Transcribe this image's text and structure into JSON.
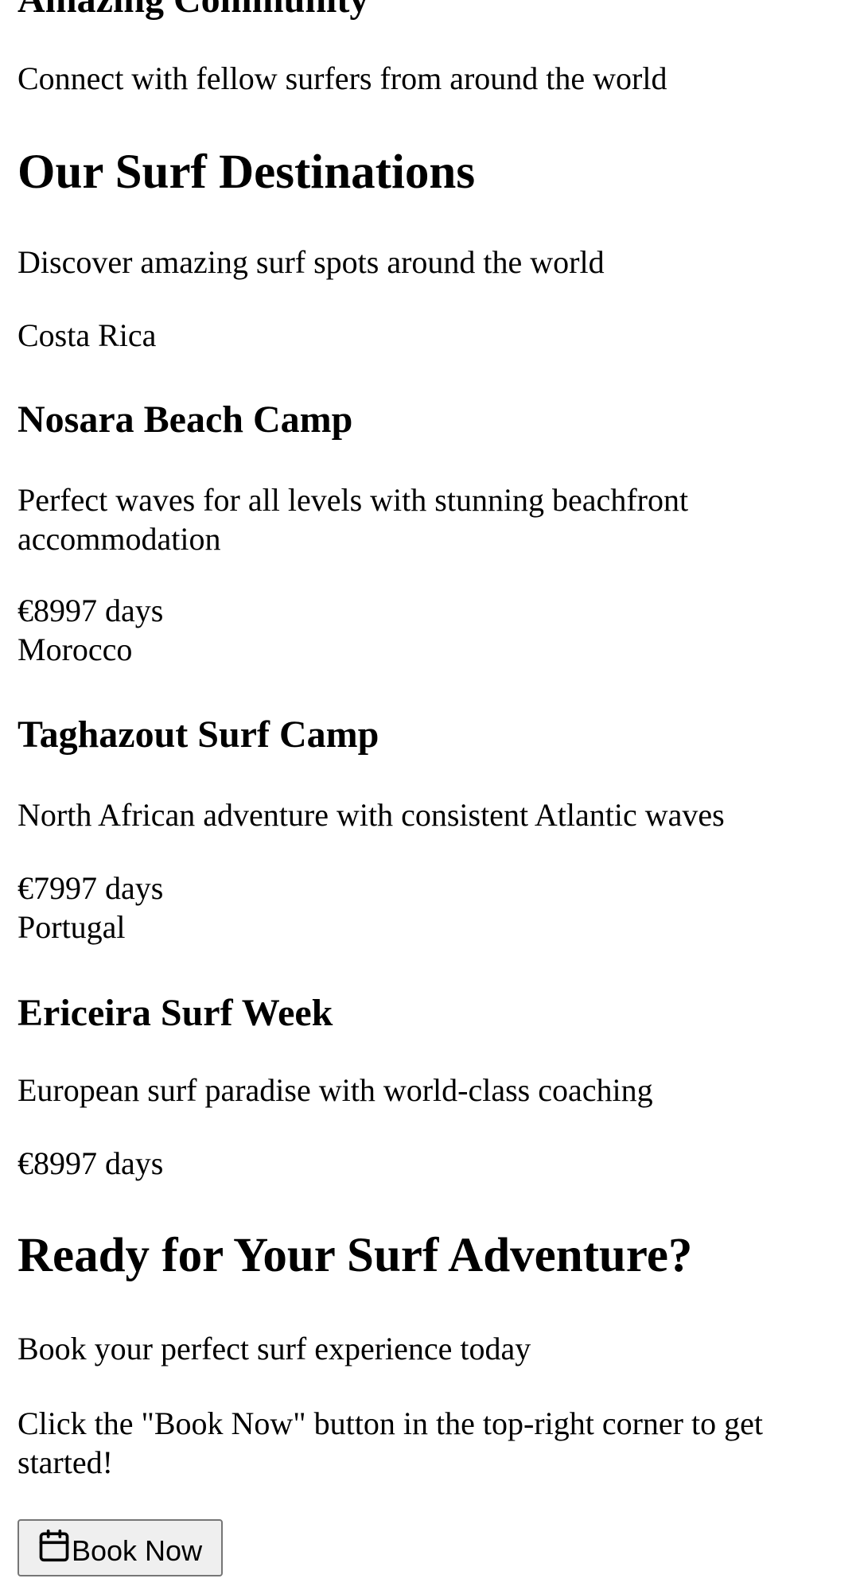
{
  "feature": {
    "title": "Amazing Community",
    "description": "Connect with fellow surfers from around the world"
  },
  "destinations": {
    "title": "Our Surf Destinations",
    "subtitle": "Discover amazing surf spots around the world",
    "items": [
      {
        "location": "Costa Rica",
        "name": "Nosara Beach Camp",
        "description": "Perfect waves for all levels with stunning beachfront accommodation",
        "price": "€899",
        "duration": "7 days"
      },
      {
        "location": "Morocco",
        "name": "Taghazout Surf Camp",
        "description": "North African adventure with consistent Atlantic waves",
        "price": "€799",
        "duration": "7 days"
      },
      {
        "location": "Portugal",
        "name": "Ericeira Surf Week",
        "description": "European surf paradise with world-class coaching",
        "price": "€899",
        "duration": "7 days"
      }
    ]
  },
  "cta": {
    "title": "Ready for Your Surf Adventure?",
    "subtitle": "Book your perfect surf experience today",
    "instruction": "Click the \"Book Now\" button in the top-right corner to get started!",
    "button_label": "Book Now",
    "button_icon": "calendar-icon"
  }
}
